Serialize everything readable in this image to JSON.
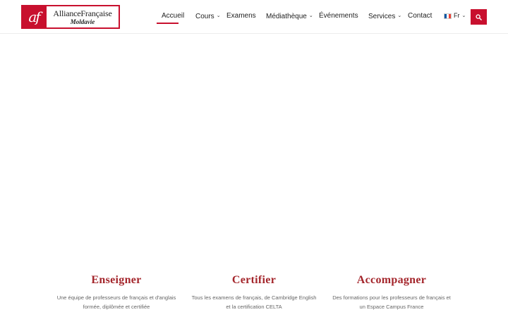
{
  "logo": {
    "mark": "af",
    "line1": "AllianceFrançaise",
    "line2": "Moldavie"
  },
  "nav": {
    "items": [
      {
        "label": "Accueil",
        "active": true,
        "dropdown": false
      },
      {
        "label": "Cours",
        "active": false,
        "dropdown": true
      },
      {
        "label": "Examens",
        "active": false,
        "dropdown": false
      },
      {
        "label": "Médiathèque",
        "active": false,
        "dropdown": true
      },
      {
        "label": "Événements",
        "active": false,
        "dropdown": false
      },
      {
        "label": "Services",
        "active": false,
        "dropdown": true
      },
      {
        "label": "Contact",
        "active": false,
        "dropdown": false
      }
    ],
    "language": "Fr",
    "language_icon": "flag-france-icon",
    "search_icon": "search-icon"
  },
  "colors": {
    "brand": "#c8102e",
    "title": "#a4262c",
    "text": "#222222",
    "muted": "#666666"
  },
  "features": [
    {
      "title": "Enseigner",
      "desc_line1": "Une équipe de professeurs de français et d'anglais",
      "desc_line2": "formée, diplômée et certifiée"
    },
    {
      "title": "Certifier",
      "desc_line1": "Tous les examens de français, de Cambridge English",
      "desc_line2": "et la certification CELTA"
    },
    {
      "title": "Accompagner",
      "desc_line1": "Des formations pour les professeurs de français et",
      "desc_line2": "un Espace Campus France"
    }
  ]
}
